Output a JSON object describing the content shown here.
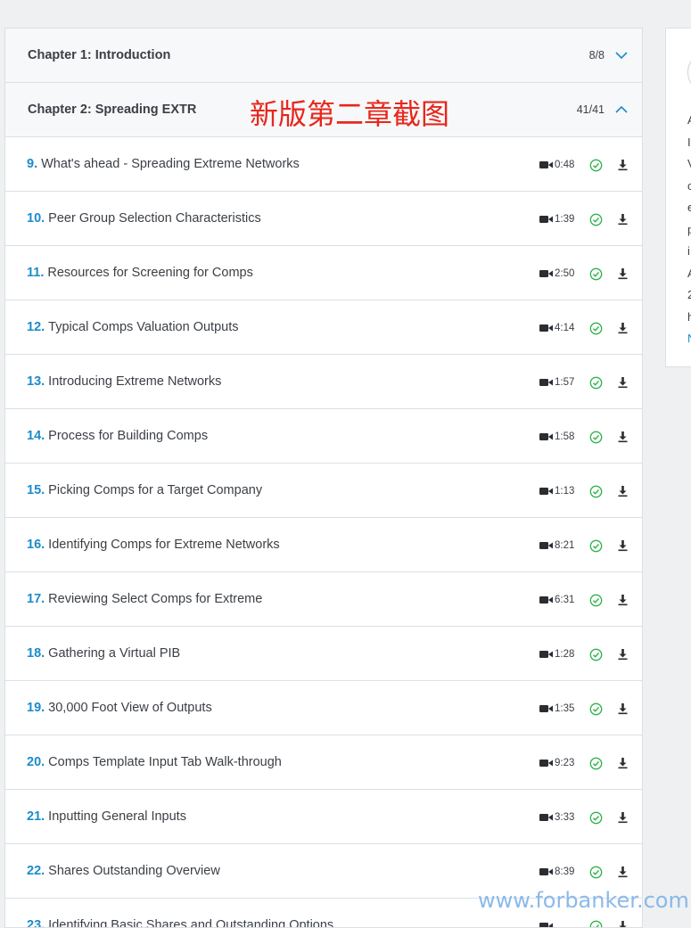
{
  "chapters": [
    {
      "title": "Chapter 1: Introduction",
      "count": "8/8",
      "expanded": false
    },
    {
      "title": "Chapter 2: Spreading EXTR",
      "count": "41/41",
      "expanded": true
    }
  ],
  "overlay_caption": "新版第二章截图",
  "lessons": [
    {
      "num": "9.",
      "title": "What's ahead - Spreading Extreme Networks",
      "duration": "0:48"
    },
    {
      "num": "10.",
      "title": "Peer Group Selection Characteristics",
      "duration": "1:39"
    },
    {
      "num": "11.",
      "title": "Resources for Screening for Comps",
      "duration": "2:50"
    },
    {
      "num": "12.",
      "title": "Typical Comps Valuation Outputs",
      "duration": "4:14"
    },
    {
      "num": "13.",
      "title": "Introducing Extreme Networks",
      "duration": "1:57"
    },
    {
      "num": "14.",
      "title": "Process for Building Comps",
      "duration": "1:58"
    },
    {
      "num": "15.",
      "title": "Picking Comps for a Target Company",
      "duration": "1:13"
    },
    {
      "num": "16.",
      "title": "Identifying Comps for Extreme Networks",
      "duration": "8:21"
    },
    {
      "num": "17.",
      "title": "Reviewing Select Comps for Extreme",
      "duration": "6:31"
    },
    {
      "num": "18.",
      "title": "Gathering a Virtual PIB",
      "duration": "1:28"
    },
    {
      "num": "19.",
      "title": "30,000 Foot View of Outputs",
      "duration": "1:35"
    },
    {
      "num": "20.",
      "title": "Comps Template Input Tab Walk-through",
      "duration": "9:23"
    },
    {
      "num": "21.",
      "title": "Inputting General Inputs",
      "duration": "3:33"
    },
    {
      "num": "22.",
      "title": "Shares Outstanding Overview",
      "duration": "8:39"
    },
    {
      "num": "23.",
      "title": "Identifying Basic Shares and Outstanding Options",
      "duration": ""
    }
  ],
  "side_card": {
    "lines": [
      "A",
      "I",
      "V",
      "c",
      "e",
      "p",
      "i",
      "A",
      "2",
      "h"
    ],
    "link": "N"
  },
  "watermark": "www.forbanker.com",
  "colors": {
    "accent_blue": "#1a8cc9",
    "check_green": "#2db24a",
    "caption_red": "#e8261c"
  }
}
